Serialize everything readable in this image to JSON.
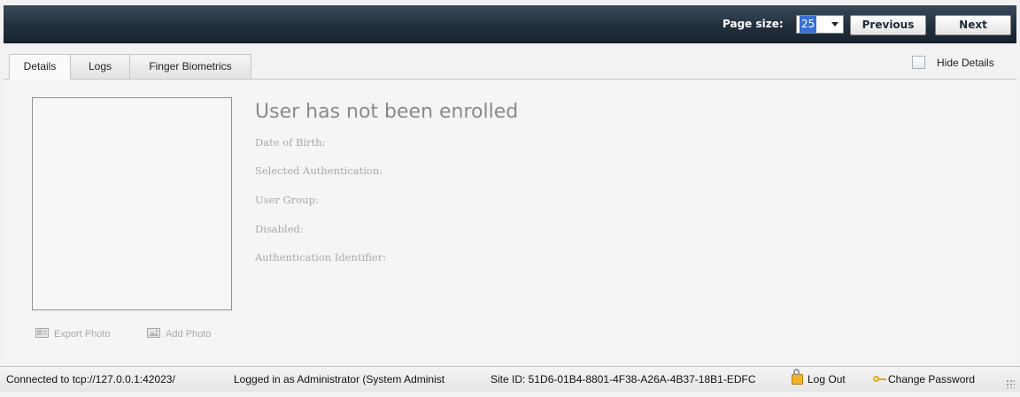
{
  "toolbar": {
    "page_size_label": "Page size:",
    "page_size_value": "25",
    "previous_label": "Previous",
    "next_label": "Next"
  },
  "tabs": [
    {
      "label": "Details",
      "active": true
    },
    {
      "label": "Logs",
      "active": false
    },
    {
      "label": "Finger Biometrics",
      "active": false
    }
  ],
  "hide_details": {
    "label": "Hide Details",
    "checked": false
  },
  "details": {
    "title": "User has not been enrolled",
    "fields": [
      {
        "label": "Date of Birth:"
      },
      {
        "label": "Selected Authentication:"
      },
      {
        "label": "User Group:"
      },
      {
        "label": "Disabled:"
      },
      {
        "label": "Authentication Identifier:"
      }
    ],
    "export_photo_label": "Export Photo",
    "add_photo_label": "Add Photo"
  },
  "status": {
    "connection": "Connected to tcp://127.0.0.1:42023/",
    "logged_in": "Logged in as Administrator (System Administ",
    "site_id": "Site ID: 51D6-01B4-8801-4F38-A26A-4B37-18B1-EDFC",
    "logout_label": "Log Out",
    "change_password_label": "Change Password"
  },
  "colors": {
    "toolbar_bg": "#22303d",
    "selection": "#3a6fd3"
  }
}
